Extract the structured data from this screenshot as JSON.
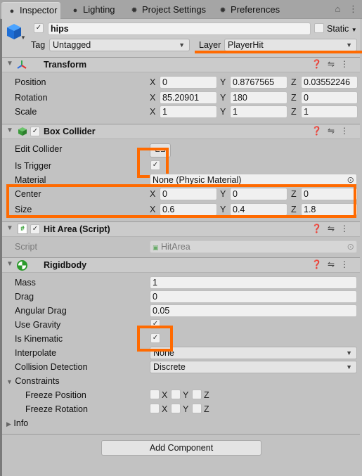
{
  "tabs": [
    {
      "label": "Inspector",
      "icon": "info-icon",
      "active": true
    },
    {
      "label": "Lighting",
      "icon": "bulb-icon"
    },
    {
      "label": "Project Settings",
      "icon": "gear-icon"
    },
    {
      "label": "Preferences",
      "icon": "gear-icon"
    }
  ],
  "object": {
    "name": "hips",
    "active": true,
    "static_label": "Static",
    "static": false,
    "tag_label": "Tag",
    "tag": "Untagged",
    "layer_label": "Layer",
    "layer": "PlayerHit"
  },
  "transform": {
    "title": "Transform",
    "rows": [
      {
        "label": "Position",
        "x": "0",
        "y": "0.8767565",
        "z": "0.03552246"
      },
      {
        "label": "Rotation",
        "x": "85.20901",
        "y": "180",
        "z": "0"
      },
      {
        "label": "Scale",
        "x": "1",
        "y": "1",
        "z": "1"
      }
    ]
  },
  "box_collider": {
    "title": "Box Collider",
    "enabled": true,
    "edit_collider_label": "Edit Collider",
    "is_trigger_label": "Is Trigger",
    "is_trigger": true,
    "material_label": "Material",
    "material": "None (Physic Material)",
    "center": {
      "label": "Center",
      "x": "0",
      "y": "0",
      "z": "0"
    },
    "size": {
      "label": "Size",
      "x": "0.6",
      "y": "0.4",
      "z": "1.8"
    }
  },
  "hit_area": {
    "title": "Hit Area (Script)",
    "enabled": true,
    "script_label": "Script",
    "script": "HitArea"
  },
  "rigidbody": {
    "title": "Rigidbody",
    "mass_label": "Mass",
    "mass": "1",
    "drag_label": "Drag",
    "drag": "0",
    "angular_drag_label": "Angular Drag",
    "angular_drag": "0.05",
    "use_gravity_label": "Use Gravity",
    "use_gravity": true,
    "is_kinematic_label": "Is Kinematic",
    "is_kinematic": true,
    "interpolate_label": "Interpolate",
    "interpolate": "None",
    "collision_label": "Collision Detection",
    "collision": "Discrete",
    "constraints_label": "Constraints",
    "freeze_position_label": "Freeze Position",
    "freeze_rotation_label": "Freeze Rotation",
    "axes": [
      "X",
      "Y",
      "Z"
    ],
    "info_label": "Info"
  },
  "axis_labels": {
    "x": "X",
    "y": "Y",
    "z": "Z"
  },
  "add_component": "Add Component",
  "highlight_color": "#ff6a00"
}
